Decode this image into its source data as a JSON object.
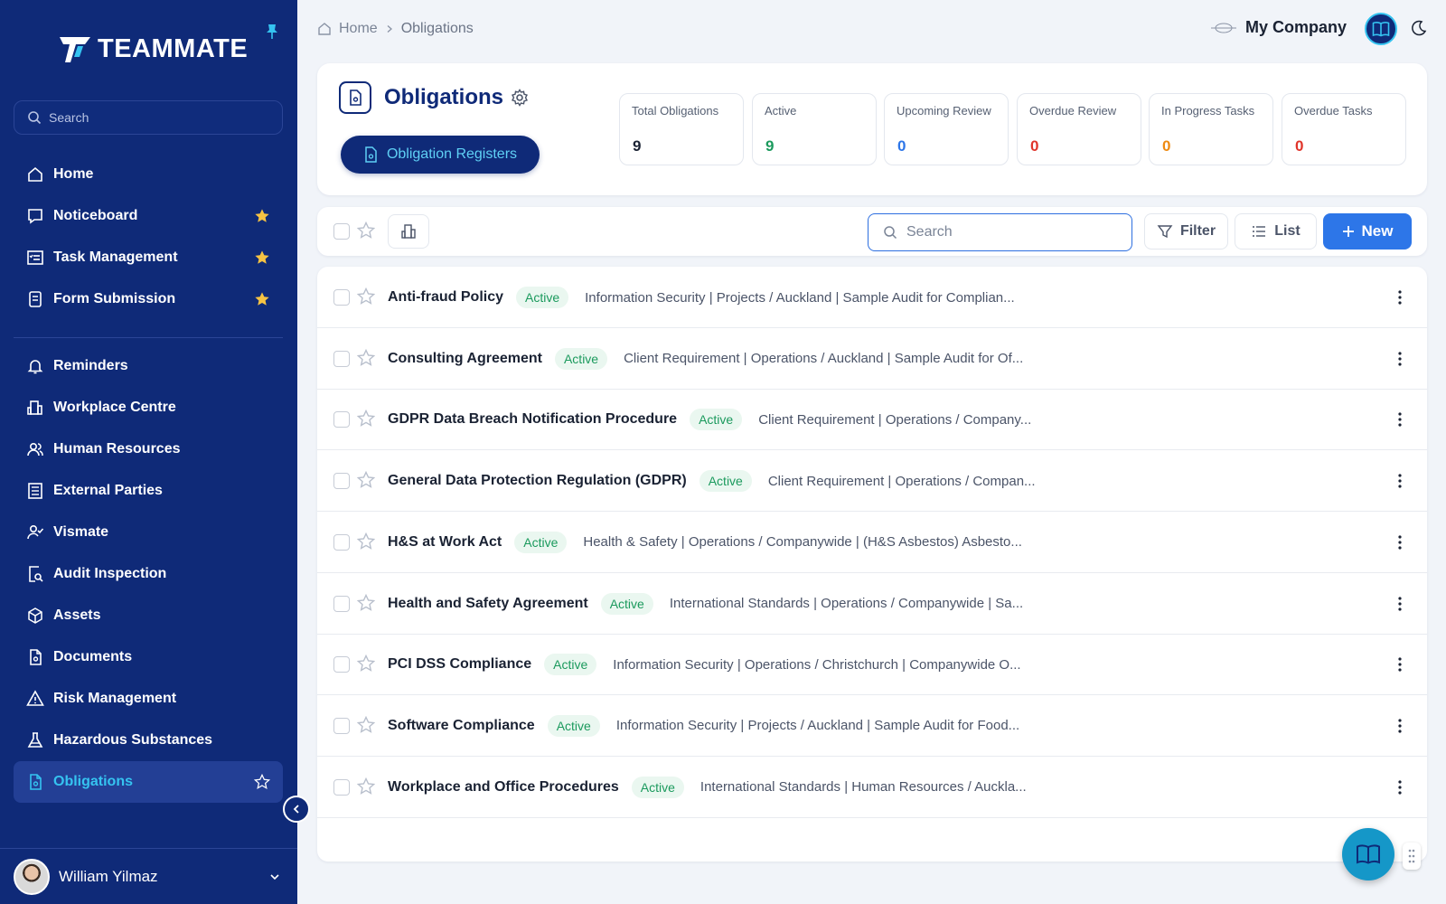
{
  "brand": {
    "name": "TEAMMATE"
  },
  "sidebar": {
    "search_placeholder": "Search",
    "items_top": [
      {
        "label": "Home",
        "icon": "home-icon",
        "starred": false
      },
      {
        "label": "Noticeboard",
        "icon": "message-icon",
        "starred": true
      },
      {
        "label": "Task Management",
        "icon": "tasks-icon",
        "starred": true
      },
      {
        "label": "Form Submission",
        "icon": "form-icon",
        "starred": true
      }
    ],
    "items_bottom": [
      {
        "label": "Reminders",
        "icon": "bell-icon"
      },
      {
        "label": "Workplace Centre",
        "icon": "building-icon"
      },
      {
        "label": "Human Resources",
        "icon": "people-icon"
      },
      {
        "label": "External Parties",
        "icon": "ledger-icon"
      },
      {
        "label": "Vismate",
        "icon": "visitor-icon"
      },
      {
        "label": "Audit Inspection",
        "icon": "audit-icon"
      },
      {
        "label": "Assets",
        "icon": "box-icon"
      },
      {
        "label": "Documents",
        "icon": "document-icon"
      },
      {
        "label": "Risk Management",
        "icon": "warning-icon"
      },
      {
        "label": "Hazardous Substances",
        "icon": "flask-icon"
      },
      {
        "label": "Obligations",
        "icon": "obligation-icon",
        "active": true
      }
    ],
    "user_name": "William Yilmaz"
  },
  "breadcrumb": {
    "home": "Home",
    "current": "Obligations"
  },
  "company": {
    "name": "My Company"
  },
  "header": {
    "title": "Obligations",
    "registers_button": "Obligation Registers",
    "stats": [
      {
        "label": "Total Obligations",
        "value": "9",
        "color": "#1a2233"
      },
      {
        "label": "Active",
        "value": "9",
        "color": "#1b9a5d"
      },
      {
        "label": "Upcoming Review",
        "value": "0",
        "color": "#2d76e8"
      },
      {
        "label": "Overdue Review",
        "value": "0",
        "color": "#e0352b"
      },
      {
        "label": "In Progress Tasks",
        "value": "0",
        "color": "#ee8a12"
      },
      {
        "label": "Overdue Tasks",
        "value": "0",
        "color": "#e0352b"
      }
    ]
  },
  "toolbar": {
    "search_placeholder": "Search",
    "filter_label": "Filter",
    "list_label": "List",
    "new_label": "New"
  },
  "obligations": [
    {
      "title": "Anti-fraud Policy",
      "status": "Active",
      "details": "Information Security | Projects / Auckland | Sample Audit for Complian..."
    },
    {
      "title": "Consulting Agreement",
      "status": "Active",
      "details": "Client Requirement | Operations / Auckland | Sample Audit for Of..."
    },
    {
      "title": "GDPR Data Breach Notification Procedure",
      "status": "Active",
      "details": "Client Requirement | Operations / Company..."
    },
    {
      "title": "General Data Protection Regulation (GDPR)",
      "status": "Active",
      "details": "Client Requirement | Operations / Compan..."
    },
    {
      "title": "H&S at Work Act",
      "status": "Active",
      "details": "Health & Safety | Operations / Companywide | (H&S Asbestos) Asbesto..."
    },
    {
      "title": "Health and Safety Agreement",
      "status": "Active",
      "details": "International Standards | Operations / Companywide | Sa..."
    },
    {
      "title": "PCI DSS Compliance",
      "status": "Active",
      "details": "Information Security | Operations / Christchurch | Companywide O..."
    },
    {
      "title": "Software Compliance",
      "status": "Active",
      "details": "Information Security | Projects / Auckland | Sample Audit for Food..."
    },
    {
      "title": "Workplace and Office Procedures",
      "status": "Active",
      "details": "International Standards | Human Resources / Auckla..."
    }
  ],
  "colors": {
    "sidebar": "#0f2a78",
    "accent": "#2d76e8",
    "active_text": "#35c3f0",
    "star": "#f6c343"
  }
}
